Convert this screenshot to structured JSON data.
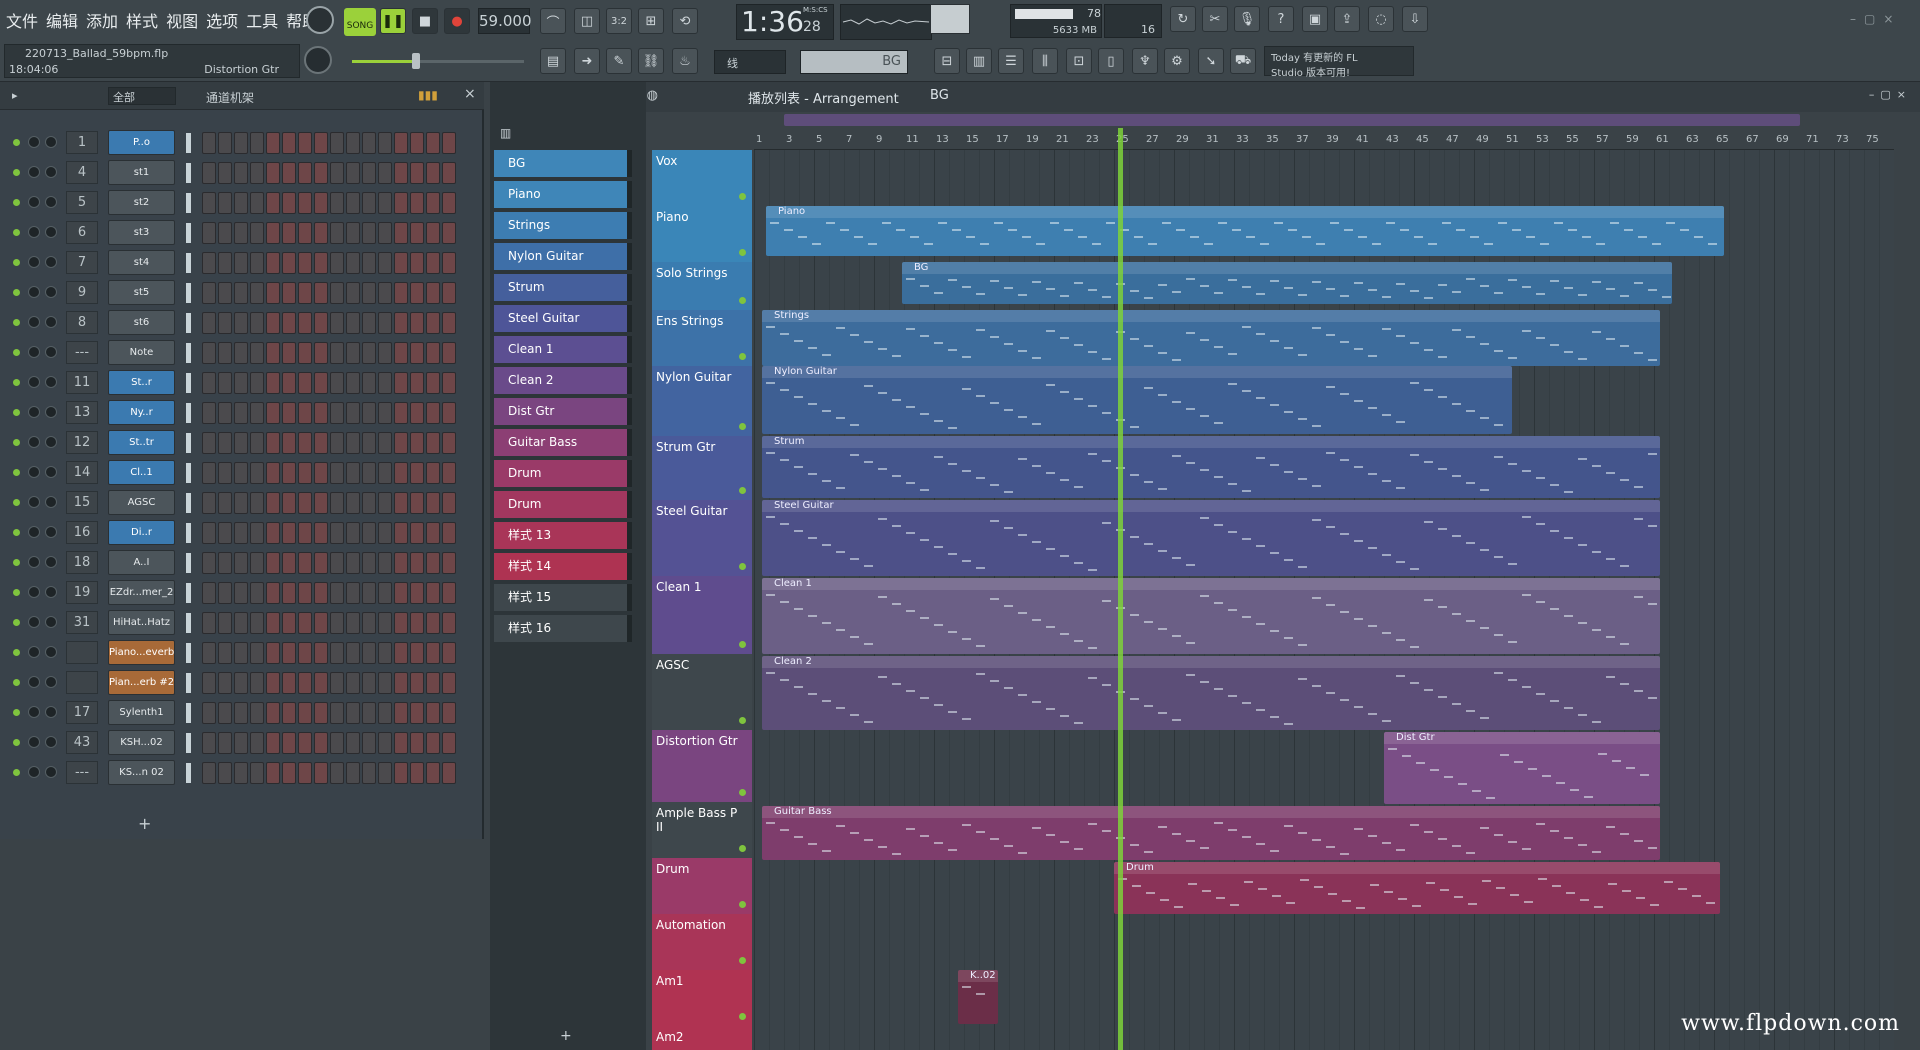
{
  "menu": [
    "文件",
    "编辑",
    "添加",
    "样式",
    "视图",
    "选项",
    "工具",
    "帮助"
  ],
  "transport": {
    "mode": "SONG",
    "tempo": "59.000",
    "time": "1:36",
    "time_sub": "28",
    "time_unit": "M:S:CS",
    "cpu": "78",
    "mem": "5633 MB",
    "voices": "16"
  },
  "hint": {
    "line1": "Today 有更新的 FL",
    "line2": "Studio 版本可用!"
  },
  "project": {
    "name": "220713_Ballad_59bpm.flp",
    "time": "18:04:06",
    "channel": "Distortion Gtr"
  },
  "snap": "线",
  "pattern_sel": "BG",
  "rack": {
    "filter": "全部",
    "title": "通道机架",
    "channels": [
      {
        "num": "1",
        "name": "P..o",
        "style": "blue"
      },
      {
        "num": "4",
        "name": "st1",
        "style": "gray"
      },
      {
        "num": "5",
        "name": "st2",
        "style": "gray"
      },
      {
        "num": "6",
        "name": "st3",
        "style": "gray"
      },
      {
        "num": "7",
        "name": "st4",
        "style": "gray"
      },
      {
        "num": "9",
        "name": "st5",
        "style": "gray"
      },
      {
        "num": "8",
        "name": "st6",
        "style": "gray"
      },
      {
        "num": "---",
        "name": "Note",
        "style": "gray"
      },
      {
        "num": "11",
        "name": "St..r",
        "style": "blue"
      },
      {
        "num": "13",
        "name": "Ny..r",
        "style": "blue"
      },
      {
        "num": "12",
        "name": "St..tr",
        "style": "blue"
      },
      {
        "num": "14",
        "name": "Cl..1",
        "style": "blue"
      },
      {
        "num": "15",
        "name": "AGSC",
        "style": "gray"
      },
      {
        "num": "16",
        "name": "Di..r",
        "style": "blue"
      },
      {
        "num": "18",
        "name": "A..I",
        "style": "gray"
      },
      {
        "num": "19",
        "name": "EZdr...mer_2",
        "style": "gray"
      },
      {
        "num": "31",
        "name": "HiHat..Hatz",
        "style": "gray"
      },
      {
        "num": "",
        "name": "Piano...everb",
        "style": "brown"
      },
      {
        "num": "",
        "name": "Pian...erb #2",
        "style": "brown"
      },
      {
        "num": "17",
        "name": "Sylenth1",
        "style": "gray"
      },
      {
        "num": "43",
        "name": "KSH...02",
        "style": "gray"
      },
      {
        "num": "---",
        "name": "KS...n 02",
        "style": "gray"
      }
    ]
  },
  "arrangement": {
    "title": "播放列表 - Arrangement",
    "crumb": "BG"
  },
  "patterns": [
    {
      "name": "BG",
      "color": "#3f86b8"
    },
    {
      "name": "Piano",
      "color": "#3f86b8"
    },
    {
      "name": "Strings",
      "color": "#3d7db2"
    },
    {
      "name": "Nylon Guitar",
      "color": "#3e6fa8"
    },
    {
      "name": "Strum",
      "color": "#455f9c"
    },
    {
      "name": "Steel Guitar",
      "color": "#4e5598"
    },
    {
      "name": "Clean 1",
      "color": "#5c4f92"
    },
    {
      "name": "Clean 2",
      "color": "#6a4a8a"
    },
    {
      "name": "Dist Gtr",
      "color": "#7a4580"
    },
    {
      "name": "Guitar Bass",
      "color": "#8c3f74"
    },
    {
      "name": "Drum",
      "color": "#9a3a68"
    },
    {
      "name": "Drum",
      "color": "#a2375f"
    },
    {
      "name": "样式 13",
      "color": "#a93558"
    },
    {
      "name": "样式 14",
      "color": "#ae3352"
    },
    {
      "name": "样式 15",
      "color": "#3e474c"
    },
    {
      "name": "样式 16",
      "color": "#3e474c"
    }
  ],
  "tracks": [
    {
      "name": "Vox",
      "color": "#3a86b8"
    },
    {
      "name": "Piano",
      "color": "#3a86b8"
    },
    {
      "name": "Solo Strings",
      "color": "#3a7cb0"
    },
    {
      "name": "Ens Strings",
      "color": "#3d72a8"
    },
    {
      "name": "Nylon Guitar",
      "color": "#4264a0"
    },
    {
      "name": "Strum Gtr",
      "color": "#4a5a9a"
    },
    {
      "name": "Steel Guitar",
      "color": "#545294"
    },
    {
      "name": "Clean 1",
      "color": "#5f4c8e"
    },
    {
      "name": "AGSC",
      "color": "#3e474c"
    },
    {
      "name": "Distortion Gtr",
      "color": "#7a4580"
    },
    {
      "name": "Ample Bass P II",
      "color": "#3e474c"
    },
    {
      "name": "Drum",
      "color": "#9a3a68"
    },
    {
      "name": "Automation",
      "color": "#a93558"
    },
    {
      "name": "Am1",
      "color": "#b03352"
    },
    {
      "name": "Am2",
      "color": "#b03352"
    }
  ],
  "clips": [
    "Piano",
    "BG",
    "Strings",
    "Nylon Guitar",
    "Strum",
    "Steel Guitar",
    "Clean 1",
    "Clean 2",
    "Dist Gtr",
    "Guitar Bass",
    "Drum",
    "K..02"
  ],
  "ruler": [
    "1",
    "3",
    "5",
    "7",
    "9",
    "11",
    "13",
    "15",
    "17",
    "19",
    "21",
    "23",
    "25",
    "27",
    "29",
    "31",
    "33",
    "35",
    "37",
    "39",
    "41",
    "43",
    "45",
    "47",
    "49",
    "51",
    "53",
    "55",
    "57",
    "59",
    "61",
    "63",
    "65",
    "67",
    "69",
    "71",
    "73",
    "75"
  ],
  "watermark": "www.flpdown.com"
}
